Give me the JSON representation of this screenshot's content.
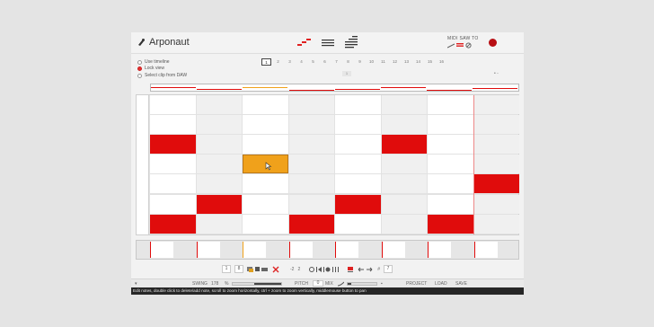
{
  "app": {
    "title": "Arponaut"
  },
  "header": {
    "midi_label": "MIDI SAW TO",
    "icons": [
      "arpeggio-icon",
      "lines-icon",
      "staircase-icon"
    ]
  },
  "options": [
    {
      "label": "Use timeline",
      "selected": false
    },
    {
      "label": "Lock view",
      "selected": true
    },
    {
      "label": "Select clip from DAW",
      "selected": false
    }
  ],
  "pages": {
    "items": [
      "1",
      "2",
      "3",
      "4",
      "5",
      "6",
      "7",
      "8",
      "9",
      "10",
      "11",
      "12",
      "13",
      "14",
      "15",
      "16"
    ],
    "active": 0
  },
  "scroll_indicator": "1",
  "nav_dots": "• -",
  "grid": {
    "columns": 8,
    "rows": 7,
    "notes": [
      {
        "col": 0,
        "row": 2,
        "color": "#e00c0c"
      },
      {
        "col": 0,
        "row": 6,
        "color": "#e00c0c"
      },
      {
        "col": 1,
        "row": 5,
        "color": "#e00c0c"
      },
      {
        "col": 2,
        "row": 3,
        "color": "#f0a11b",
        "selected": true
      },
      {
        "col": 3,
        "row": 6,
        "color": "#e00c0c"
      },
      {
        "col": 4,
        "row": 5,
        "color": "#e00c0c"
      },
      {
        "col": 5,
        "row": 2,
        "color": "#e00c0c"
      },
      {
        "col": 6,
        "row": 6,
        "color": "#e00c0c"
      },
      {
        "col": 7,
        "row": 4,
        "color": "#e00c0c"
      }
    ]
  },
  "toolbar": {
    "steps": "1",
    "steps_total": "8",
    "octave_down": "-2",
    "octave_up": "2",
    "transpose_label": "#",
    "transpose_value": "7"
  },
  "footer": {
    "swing_label": "SWING",
    "swing_value": "178",
    "percent_label": "%",
    "pitch_label": "PITCH",
    "pitch_value": "0",
    "mix_label": "MIX",
    "project_label": "PROJECT",
    "load_label": "LOAD",
    "save_label": "SAVE"
  },
  "status": "Edit notes, double click to delete/add note, scroll to zoom horizontally, ctrl + zoom to zoom vertically, middlemouse button to pan",
  "colors": {
    "note": "#e00c0c",
    "selected_note": "#f0a11b",
    "record": "#b80f14",
    "accent": "#e43030"
  }
}
